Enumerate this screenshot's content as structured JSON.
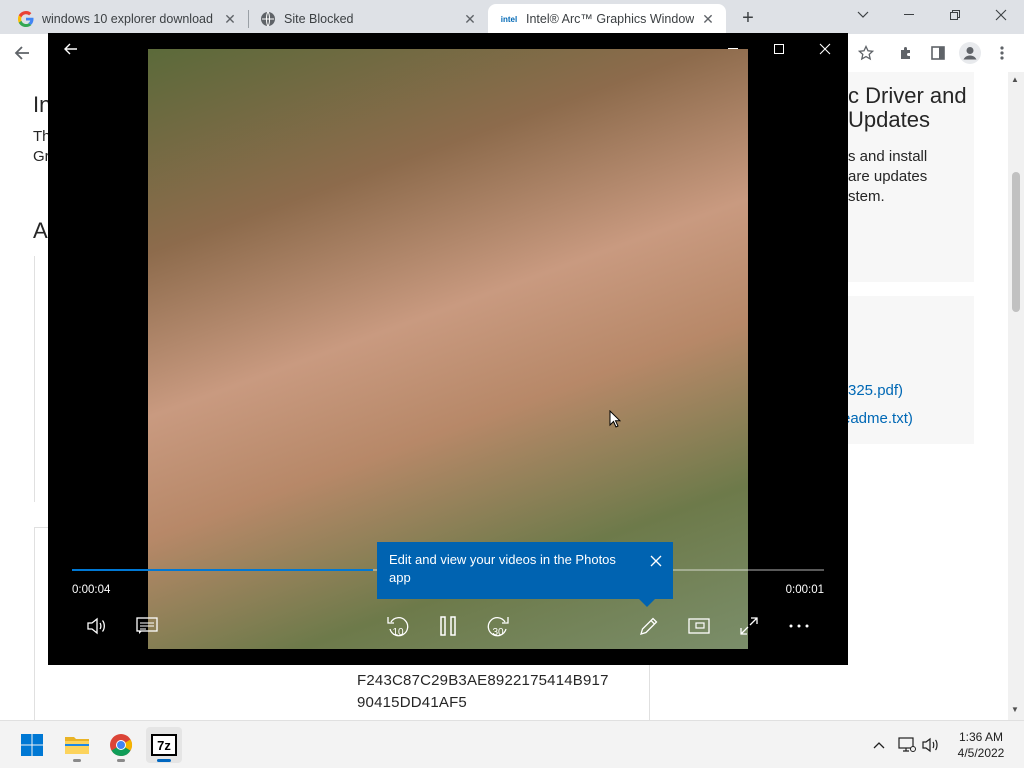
{
  "tabs": [
    {
      "title": "windows 10 explorer download -",
      "icon": "google-g-icon"
    },
    {
      "title": "Site Blocked",
      "icon": "globe-icon"
    },
    {
      "title": "Intel® Arc™ Graphics Windows®",
      "icon": "intel-logo-icon",
      "favicon_text": "intel",
      "active": true
    }
  ],
  "page": {
    "heading_left": "In",
    "text_left_1": "Th",
    "text_left_2": "Gr",
    "subheading_left": "A",
    "heading_right_1": "c Driver and",
    "heading_right_2": "Updates",
    "desc_1": "s and install",
    "desc_2": "are updates",
    "desc_3": "stem.",
    "link_1": "325.pdf)",
    "link_2": "eadme.txt)",
    "hash_1": "F243C87C29B3AE8922175414B917",
    "hash_2": "90415DD41AF5"
  },
  "player": {
    "time_elapsed": "0:00:04",
    "time_remaining": "0:00:01",
    "progress": 0.4,
    "tooltip": "Edit and view your videos in the Photos app",
    "skip_back_seconds": "10",
    "skip_forward_seconds": "30"
  },
  "taskbar": {
    "apps": [
      "start-button",
      "file-explorer",
      "chrome",
      "7-zip"
    ],
    "sevenzip_label": "7z",
    "time": "1:36 AM",
    "date": "4/5/2022"
  },
  "colors": {
    "accent": "#0078d4",
    "tooltip_bg": "#0063b1",
    "intel_link": "#0068b5"
  }
}
